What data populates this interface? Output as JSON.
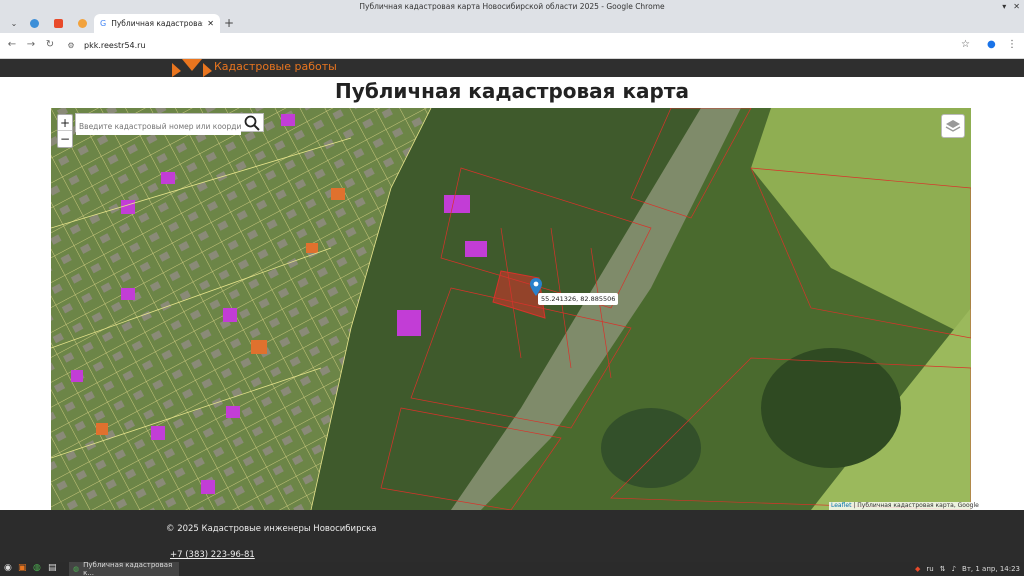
{
  "window": {
    "title": "Публичная кадастровая карта Новосибирской области 2025 - Google Chrome",
    "controls": [
      "▾",
      "✕"
    ]
  },
  "tabs": {
    "active_label": "Публичная кадастровая карта",
    "new_tab": "+"
  },
  "address": {
    "url": "pkk.reestr54.ru"
  },
  "site": {
    "logo_text": "Кадастровые работы",
    "page_title": "Публичная кадастровая карта"
  },
  "map": {
    "zoom_in": "+",
    "zoom_out": "−",
    "search_placeholder": "Введите кадастровый номер или координаты",
    "popup": "55.241326, 82.885506",
    "attribution_link": "Leaflet",
    "attribution_text": " | Публичная кадастровая карта, Google"
  },
  "footer": {
    "copyright": "© 2025 Кадастровые инженеры Новосибирска",
    "phone": "+7 (383) 223-96-81"
  },
  "taskbar": {
    "app_label": "Публичная кадастровая к...",
    "lang": "ru",
    "clock": "Вт, 1 апр, 14:23"
  },
  "colors": {
    "accent_orange": "#e9751f",
    "parcel_red": "#d9322a",
    "header_dark": "#2f2f2f"
  }
}
